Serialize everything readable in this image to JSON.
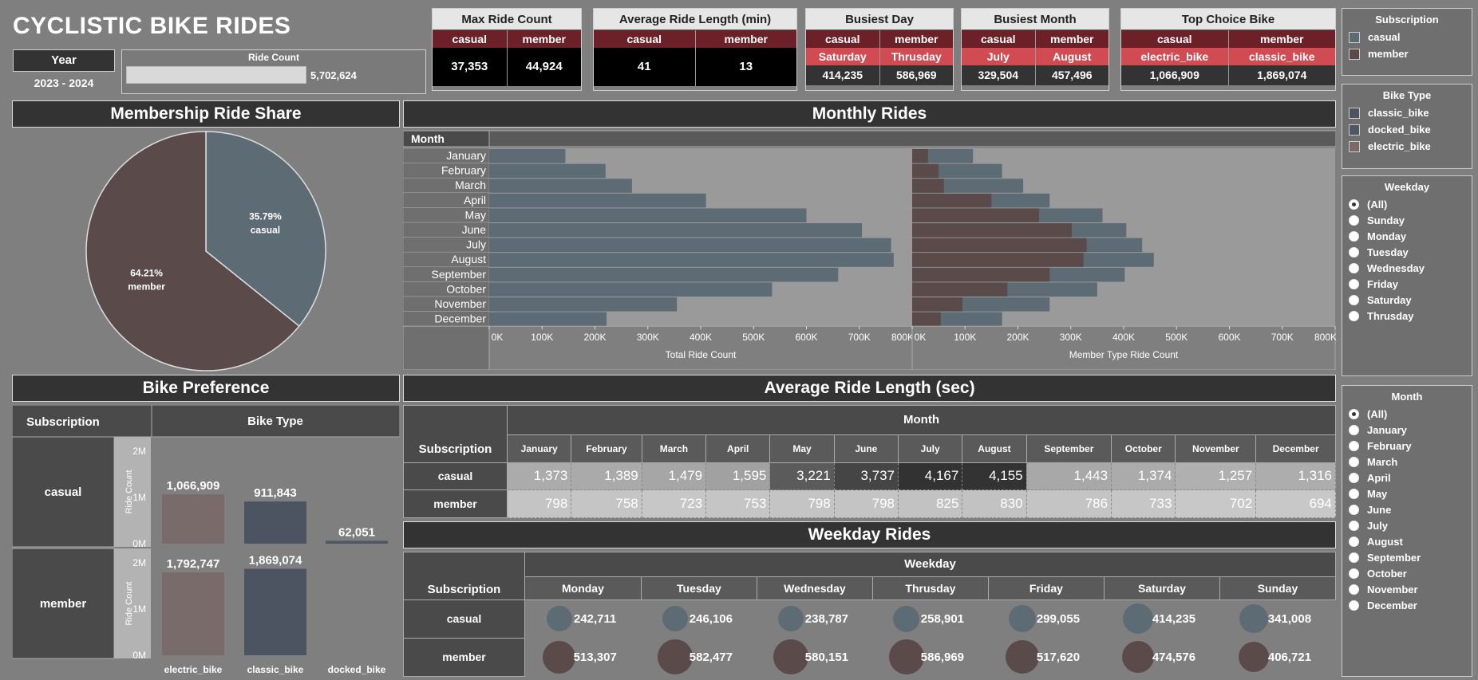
{
  "title": "CYCLISTIC BIKE RIDES",
  "year": {
    "label": "Year",
    "value": "2023 - 2024"
  },
  "ride_count": {
    "label": "Ride Count",
    "value": "5,702,624",
    "fill_fraction": 1.0
  },
  "kpis": [
    {
      "title": "Max Ride Count",
      "cols": [
        "casual",
        "member"
      ],
      "values": [
        "37,353",
        "44,924"
      ]
    },
    {
      "title": "Average Ride Length (min)",
      "cols": [
        "casual",
        "member"
      ],
      "values": [
        "41",
        "13"
      ]
    },
    {
      "title": "Busiest Day",
      "cols": [
        "casual",
        "member"
      ],
      "labels": [
        "Saturday",
        "Thrusday"
      ],
      "values": [
        "414,235",
        "586,969"
      ]
    },
    {
      "title": "Busiest Month",
      "cols": [
        "casual",
        "member"
      ],
      "labels": [
        "July",
        "August"
      ],
      "values": [
        "329,504",
        "457,496"
      ]
    },
    {
      "title": "Top Choice Bike",
      "cols": [
        "casual",
        "member"
      ],
      "labels": [
        "electric_bike",
        "classic_bike"
      ],
      "values": [
        "1,066,909",
        "1,869,074"
      ]
    }
  ],
  "legends": {
    "subscription": {
      "title": "Subscription",
      "items": [
        {
          "label": "casual",
          "color": "#5d6b75"
        },
        {
          "label": "member",
          "color": "#5a4a4a"
        }
      ]
    },
    "bike_type": {
      "title": "Bike Type",
      "items": [
        {
          "label": "classic_bike",
          "color": "#4c5361"
        },
        {
          "label": "docked_bike",
          "color": "#4f5763"
        },
        {
          "label": "electric_bike",
          "color": "#7a6b6b"
        }
      ]
    }
  },
  "filters": {
    "weekday": {
      "title": "Weekday",
      "options": [
        "(All)",
        "Sunday",
        "Monday",
        "Tuesday",
        "Wednesday",
        "Friday",
        "Saturday",
        "Thrusday"
      ],
      "selected": "(All)"
    },
    "month": {
      "title": "Month",
      "options": [
        "(All)",
        "January",
        "February",
        "March",
        "April",
        "May",
        "June",
        "July",
        "August",
        "September",
        "October",
        "November",
        "December"
      ],
      "selected": "(All)"
    }
  },
  "sections": {
    "pie": "Membership Ride Share",
    "monthly": "Monthly Rides",
    "bike": "Bike Preference",
    "avg": "Average Ride Length (sec)",
    "weekday": "Weekday Rides"
  },
  "colors": {
    "casual": "#5d6b75",
    "member": "#5a4a4a",
    "classic": "#4c5361",
    "electric": "#7a6b6b",
    "docked": "#4f5763",
    "header": "#333333",
    "accent": "#d14b53"
  },
  "chart_data": [
    {
      "type": "pie",
      "title": "Membership Ride Share",
      "slices": [
        {
          "label": "casual",
          "value": 35.79,
          "text": "35.79%"
        },
        {
          "label": "member",
          "value": 64.21,
          "text": "64.21%"
        }
      ]
    },
    {
      "type": "bar",
      "title": "Monthly Rides",
      "row_header": "Month",
      "categories": [
        "January",
        "February",
        "March",
        "April",
        "May",
        "June",
        "July",
        "August",
        "September",
        "October",
        "November",
        "December"
      ],
      "total": {
        "xlabel": "Total Ride Count",
        "values": [
          144000,
          220000,
          270000,
          410000,
          600000,
          705000,
          760000,
          765000,
          660000,
          535000,
          355000,
          222000
        ]
      },
      "member_type": {
        "xlabel": "Member Type Ride Count",
        "series": [
          {
            "name": "casual",
            "values": [
              30000,
              50000,
              60000,
              150000,
              240000,
              302000,
              330000,
              324000,
              260000,
              180000,
              95000,
              54000
            ]
          },
          {
            "name": "member",
            "values": [
              115000,
              170000,
              210000,
              260000,
              360000,
              405000,
              435000,
              457000,
              402000,
              350000,
              260000,
              170000
            ]
          }
        ]
      },
      "xlim": [
        0,
        800000
      ],
      "xticks": [
        "0K",
        "100K",
        "200K",
        "300K",
        "400K",
        "500K",
        "600K",
        "700K",
        "800K"
      ]
    },
    {
      "type": "bar",
      "title": "Bike Preference",
      "row_header": "Subscription",
      "col_header": "Bike Type",
      "ylabel": "Ride Count",
      "categories": [
        "electric_bike",
        "classic_bike",
        "docked_bike"
      ],
      "yticks": [
        "2M",
        "1M",
        "0M"
      ],
      "ylim": [
        0,
        2000000
      ],
      "series": [
        {
          "name": "casual",
          "values": [
            1066909,
            911843,
            62051
          ],
          "labels": [
            "1,066,909",
            "911,843",
            "62,051"
          ]
        },
        {
          "name": "member",
          "values": [
            1792747,
            1869074,
            0
          ],
          "labels": [
            "1,792,747",
            "1,869,074",
            ""
          ]
        }
      ]
    },
    {
      "type": "table",
      "title": "Average Ride Length (sec)",
      "row_header": "Subscription",
      "col_header": "Month",
      "columns": [
        "January",
        "February",
        "March",
        "April",
        "May",
        "June",
        "July",
        "August",
        "September",
        "October",
        "November",
        "December"
      ],
      "rows": [
        {
          "name": "casual",
          "values": [
            "1,373",
            "1,389",
            "1,479",
            "1,595",
            "3,221",
            "3,737",
            "4,167",
            "4,155",
            "1,443",
            "1,374",
            "1,257",
            "1,316"
          ]
        },
        {
          "name": "member",
          "values": [
            "798",
            "758",
            "723",
            "753",
            "798",
            "798",
            "825",
            "830",
            "786",
            "733",
            "702",
            "694"
          ]
        }
      ]
    },
    {
      "type": "table",
      "title": "Weekday Rides",
      "row_header": "Subscription",
      "col_header": "Weekday",
      "columns": [
        "Monday",
        "Tuesday",
        "Wednesday",
        "Thrusday",
        "Friday",
        "Saturday",
        "Sunday"
      ],
      "rows": [
        {
          "name": "casual",
          "values": [
            "242,711",
            "246,106",
            "238,787",
            "258,901",
            "299,055",
            "414,235",
            "341,008"
          ]
        },
        {
          "name": "member",
          "values": [
            "513,307",
            "582,477",
            "580,151",
            "586,969",
            "517,620",
            "474,576",
            "406,721"
          ]
        }
      ]
    }
  ]
}
